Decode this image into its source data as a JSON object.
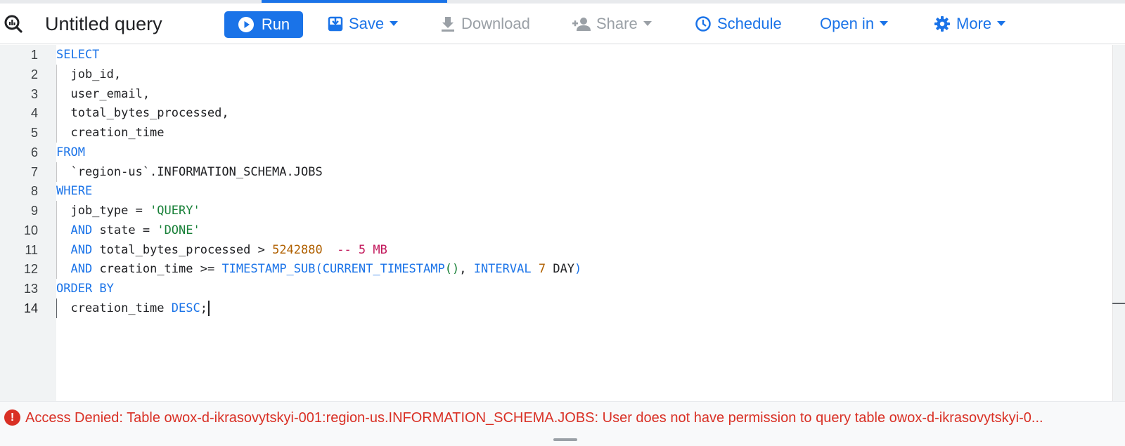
{
  "toolbar": {
    "title": "Untitled query",
    "run_label": "Run",
    "save_label": "Save",
    "download_label": "Download",
    "share_label": "Share",
    "schedule_label": "Schedule",
    "open_in_label": "Open in",
    "more_label": "More"
  },
  "icons": [
    "query-icon",
    "play-icon",
    "save-icon",
    "download-icon",
    "share-person-icon",
    "clock-icon",
    "gear-icon",
    "chevron-down-icon",
    "error-icon"
  ],
  "colors": {
    "accent": "#1a73e8",
    "error": "#d93025",
    "string": "#188038",
    "number": "#b06000",
    "comment": "#c2185b"
  },
  "editor": {
    "current_line": 14,
    "lines": [
      {
        "n": "1",
        "tokens": [
          {
            "t": "SELECT",
            "k": "kw"
          }
        ]
      },
      {
        "n": "2",
        "tokens": [
          {
            "t": "  job_id,",
            "k": ""
          }
        ]
      },
      {
        "n": "3",
        "tokens": [
          {
            "t": "  user_email,",
            "k": ""
          }
        ]
      },
      {
        "n": "4",
        "tokens": [
          {
            "t": "  total_bytes_processed,",
            "k": ""
          }
        ]
      },
      {
        "n": "5",
        "tokens": [
          {
            "t": "  creation_time",
            "k": ""
          }
        ]
      },
      {
        "n": "6",
        "tokens": [
          {
            "t": "FROM",
            "k": "kw"
          }
        ]
      },
      {
        "n": "7",
        "tokens": [
          {
            "t": "  `region-us`.INFORMATION_SCHEMA.JOBS",
            "k": ""
          }
        ]
      },
      {
        "n": "8",
        "tokens": [
          {
            "t": "WHERE",
            "k": "kw"
          }
        ]
      },
      {
        "n": "9",
        "tokens": [
          {
            "t": "  job_type = ",
            "k": ""
          },
          {
            "t": "'QUERY'",
            "k": "str"
          }
        ]
      },
      {
        "n": "10",
        "tokens": [
          {
            "t": "  ",
            "k": ""
          },
          {
            "t": "AND",
            "k": "kw"
          },
          {
            "t": " state = ",
            "k": ""
          },
          {
            "t": "'DONE'",
            "k": "str"
          }
        ]
      },
      {
        "n": "11",
        "tokens": [
          {
            "t": "  ",
            "k": ""
          },
          {
            "t": "AND",
            "k": "kw"
          },
          {
            "t": " total_bytes_processed > ",
            "k": ""
          },
          {
            "t": "5242880",
            "k": "num"
          },
          {
            "t": "  ",
            "k": ""
          },
          {
            "t": "-- 5 MB",
            "k": "cmt"
          }
        ]
      },
      {
        "n": "12",
        "tokens": [
          {
            "t": "  ",
            "k": ""
          },
          {
            "t": "AND",
            "k": "kw"
          },
          {
            "t": " creation_time >= ",
            "k": ""
          },
          {
            "t": "TIMESTAMP_SUB(",
            "k": "fn"
          },
          {
            "t": "CURRENT_TIMESTAMP",
            "k": "fn"
          },
          {
            "t": "()",
            "k": "paren"
          },
          {
            "t": ", ",
            "k": ""
          },
          {
            "t": "INTERVAL",
            "k": "kw"
          },
          {
            "t": " ",
            "k": ""
          },
          {
            "t": "7",
            "k": "num"
          },
          {
            "t": " DAY",
            "k": ""
          },
          {
            "t": ")",
            "k": "fn"
          }
        ]
      },
      {
        "n": "13",
        "tokens": [
          {
            "t": "ORDER BY",
            "k": "kw"
          }
        ]
      },
      {
        "n": "14",
        "tokens": [
          {
            "t": "  creation_time ",
            "k": ""
          },
          {
            "t": "DESC",
            "k": "kw"
          },
          {
            "t": ";",
            "k": ""
          }
        ]
      }
    ]
  },
  "error": {
    "message": "Access Denied: Table owox-d-ikrasovytskyi-001:region-us.INFORMATION_SCHEMA.JOBS: User does not have permission to query table owox-d-ikrasovytskyi-0..."
  }
}
